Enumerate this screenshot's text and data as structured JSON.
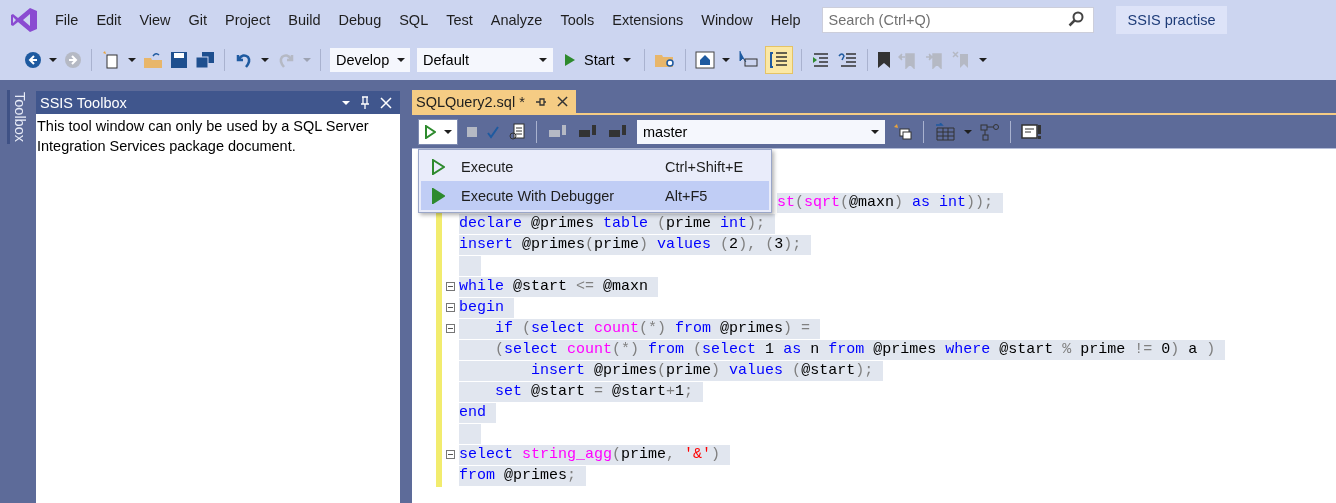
{
  "menu": [
    "File",
    "Edit",
    "View",
    "Git",
    "Project",
    "Build",
    "Debug",
    "SQL",
    "Test",
    "Analyze",
    "Tools",
    "Extensions",
    "Window",
    "Help"
  ],
  "search": {
    "placeholder": "Search (Ctrl+Q)"
  },
  "solution": "SSIS practise",
  "toolbar": {
    "configuration": "Develop",
    "platform": "Default",
    "start": "Start",
    "toggle_on": true
  },
  "side_tab": "Toolbox",
  "toolbox": {
    "title": "SSIS Toolbox",
    "message": "This tool window can only be used by a SQL Server Integration Services package document."
  },
  "document_tab": {
    "title": "SQLQuery2.sql *",
    "selected": true
  },
  "editor_toolbar": {
    "database": "master"
  },
  "execute_menu": [
    {
      "label": "Execute",
      "shortcut": "Ctrl+Shift+E",
      "selected": false
    },
    {
      "label": "Execute With Debugger",
      "shortcut": "Alt+F5",
      "selected": true
    }
  ],
  "code": [
    {
      "fold": false,
      "tokens": [
        {
          "kind": "function",
          "text": "st"
        },
        {
          "kind": "operator",
          "text": "("
        },
        {
          "kind": "function",
          "text": "sqrt"
        },
        {
          "kind": "operator",
          "text": "("
        },
        {
          "kind": "plain",
          "text": "@maxn"
        },
        {
          "kind": "operator",
          "text": ")"
        },
        {
          "kind": "keyword",
          "text": " as int"
        },
        {
          "kind": "operator",
          "text": "));"
        }
      ]
    },
    {
      "fold": false,
      "tokens": [
        {
          "kind": "keyword",
          "text": "declare"
        },
        {
          "kind": "plain",
          "text": " @primes "
        },
        {
          "kind": "keyword",
          "text": "table "
        },
        {
          "kind": "operator",
          "text": "("
        },
        {
          "kind": "plain",
          "text": "prime "
        },
        {
          "kind": "keyword",
          "text": "int"
        },
        {
          "kind": "operator",
          "text": ");"
        }
      ]
    },
    {
      "fold": false,
      "tokens": [
        {
          "kind": "keyword",
          "text": "insert"
        },
        {
          "kind": "plain",
          "text": " @primes"
        },
        {
          "kind": "operator",
          "text": "("
        },
        {
          "kind": "plain",
          "text": "prime"
        },
        {
          "kind": "operator",
          "text": ")"
        },
        {
          "kind": "keyword",
          "text": " values "
        },
        {
          "kind": "operator",
          "text": "("
        },
        {
          "kind": "plain",
          "text": "2"
        },
        {
          "kind": "operator",
          "text": "), ("
        },
        {
          "kind": "plain",
          "text": "3"
        },
        {
          "kind": "operator",
          "text": ");"
        }
      ]
    },
    {
      "fold": false
    },
    {
      "fold": true,
      "tokens": [
        {
          "kind": "keyword",
          "text": "while"
        },
        {
          "kind": "plain",
          "text": " @start "
        },
        {
          "kind": "operator",
          "text": "<="
        },
        {
          "kind": "plain",
          "text": " @maxn"
        }
      ]
    },
    {
      "fold": true,
      "tokens": [
        {
          "kind": "keyword",
          "text": "begin"
        }
      ]
    },
    {
      "fold": true,
      "tokens": [
        {
          "kind": "keyword",
          "text": "    if "
        },
        {
          "kind": "operator",
          "text": "("
        },
        {
          "kind": "keyword",
          "text": "select "
        },
        {
          "kind": "function",
          "text": "count"
        },
        {
          "kind": "operator",
          "text": "(*)"
        },
        {
          "kind": "keyword",
          "text": " from"
        },
        {
          "kind": "plain",
          "text": " @primes"
        },
        {
          "kind": "operator",
          "text": ") ="
        }
      ]
    },
    {
      "fold": false,
      "tokens": [
        {
          "kind": "operator",
          "text": "    ("
        },
        {
          "kind": "keyword",
          "text": "select "
        },
        {
          "kind": "function",
          "text": "count"
        },
        {
          "kind": "operator",
          "text": "(*)"
        },
        {
          "kind": "keyword",
          "text": " from "
        },
        {
          "kind": "operator",
          "text": "("
        },
        {
          "kind": "keyword",
          "text": "select"
        },
        {
          "kind": "plain",
          "text": " 1 "
        },
        {
          "kind": "keyword",
          "text": "as"
        },
        {
          "kind": "plain",
          "text": " n "
        },
        {
          "kind": "keyword",
          "text": "from"
        },
        {
          "kind": "plain",
          "text": " @primes "
        },
        {
          "kind": "keyword",
          "text": "where"
        },
        {
          "kind": "plain",
          "text": " @start "
        },
        {
          "kind": "operator",
          "text": "%"
        },
        {
          "kind": "plain",
          "text": " prime "
        },
        {
          "kind": "operator",
          "text": "!="
        },
        {
          "kind": "plain",
          "text": " 0"
        },
        {
          "kind": "operator",
          "text": ")"
        },
        {
          "kind": "plain",
          "text": " a "
        },
        {
          "kind": "operator",
          "text": ")"
        }
      ]
    },
    {
      "fold": false,
      "tokens": [
        {
          "kind": "keyword",
          "text": "        insert"
        },
        {
          "kind": "plain",
          "text": " @primes"
        },
        {
          "kind": "operator",
          "text": "("
        },
        {
          "kind": "plain",
          "text": "prime"
        },
        {
          "kind": "operator",
          "text": ")"
        },
        {
          "kind": "keyword",
          "text": " values "
        },
        {
          "kind": "operator",
          "text": "("
        },
        {
          "kind": "plain",
          "text": "@start"
        },
        {
          "kind": "operator",
          "text": ");"
        }
      ]
    },
    {
      "fold": false,
      "tokens": [
        {
          "kind": "keyword",
          "text": "    set"
        },
        {
          "kind": "plain",
          "text": " @start "
        },
        {
          "kind": "operator",
          "text": "="
        },
        {
          "kind": "plain",
          "text": " @start"
        },
        {
          "kind": "operator",
          "text": "+"
        },
        {
          "kind": "plain",
          "text": "1"
        },
        {
          "kind": "operator",
          "text": ";"
        }
      ]
    },
    {
      "fold": false,
      "tokens": [
        {
          "kind": "keyword",
          "text": "end"
        }
      ]
    },
    {
      "fold": false
    },
    {
      "fold": true,
      "tokens": [
        {
          "kind": "keyword",
          "text": "select "
        },
        {
          "kind": "function",
          "text": "string_agg"
        },
        {
          "kind": "operator",
          "text": "("
        },
        {
          "kind": "plain",
          "text": "prime"
        },
        {
          "kind": "operator",
          "text": ", "
        },
        {
          "kind": "string",
          "text": "'&'"
        },
        {
          "kind": "operator",
          "text": ")"
        }
      ]
    },
    {
      "fold": false,
      "tokens": [
        {
          "kind": "keyword",
          "text": "from"
        },
        {
          "kind": "plain",
          "text": " @primes"
        },
        {
          "kind": "operator",
          "text": ";"
        }
      ]
    }
  ]
}
